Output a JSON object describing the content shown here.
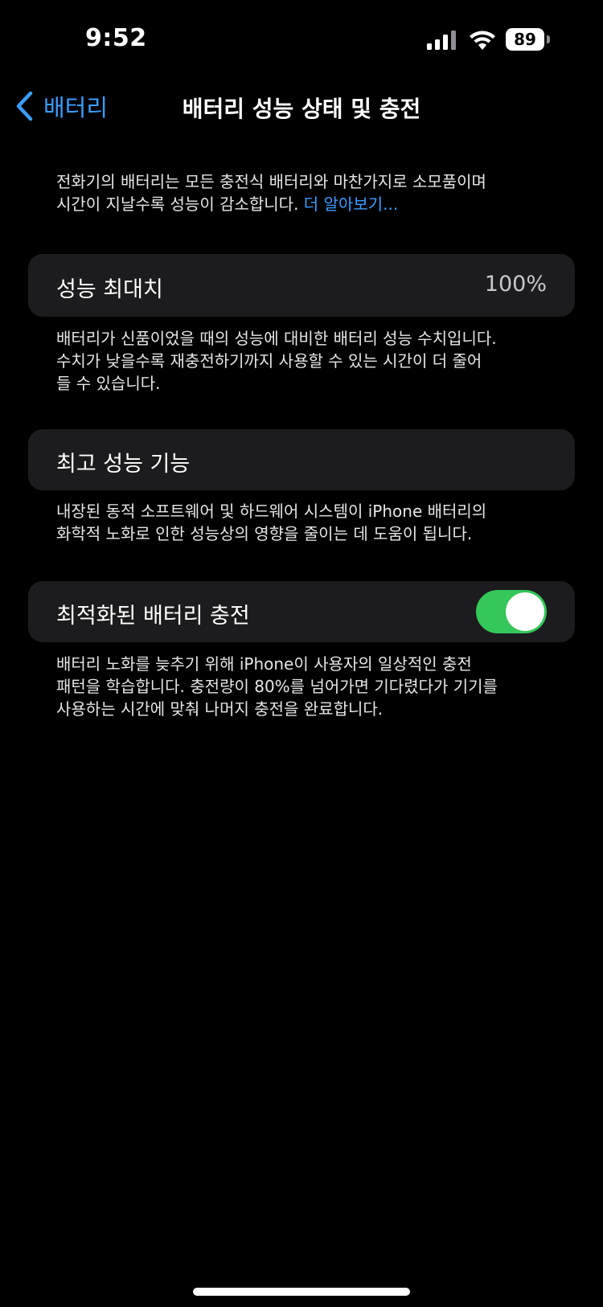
{
  "status_bar": {
    "time": "9:52",
    "battery_level": "89",
    "icons": [
      "signal-icon",
      "wifi-icon",
      "battery-icon"
    ]
  },
  "nav": {
    "back_label": "배터리",
    "title": "배터리 성능 상태 및 충전"
  },
  "intro": {
    "line1": "전화기의 배터리는 모든 충전식 배터리와 마찬가지로 소모품이며",
    "line2": "시간이 지날수록 성능이 감소합니다.",
    "link": "더 알아보기..."
  },
  "max_capacity": {
    "label": "성능 최대치",
    "value": "100%",
    "footer_line1": "배터리가 신품이었을 때의 성능에 대비한 배터리 성능 수치입니다.",
    "footer_line2": "수치가 낮을수록 재충전하기까지 사용할 수 있는 시간이 더 줄어",
    "footer_line3": "들 수 있습니다."
  },
  "peak_performance": {
    "label": "최고 성능 기능",
    "footer_line1": "내장된 동적 소프트웨어 및 하드웨어 시스템이 iPhone 배터리의",
    "footer_line2": "화학적 노화로 인한 성능상의 영향을 줄이는 데 도움이 됩니다."
  },
  "optimized_charging": {
    "label": "최적화된 배터리 충전",
    "enabled": true,
    "footer_line1": "배터리 노화를 늦추기 위해 iPhone이 사용자의 일상적인 충전",
    "footer_line2": "패턴을 학습합니다. 충전량이 80%를 넘어가면 기다렸다가 기기를",
    "footer_line3": "사용하는 시간에 맞춰 나머지 충전을 완료합니다."
  },
  "colors": {
    "background": "#000000",
    "cell": "#1c1c1e",
    "accent": "#3b9dff",
    "toggle_on": "#34c759"
  }
}
